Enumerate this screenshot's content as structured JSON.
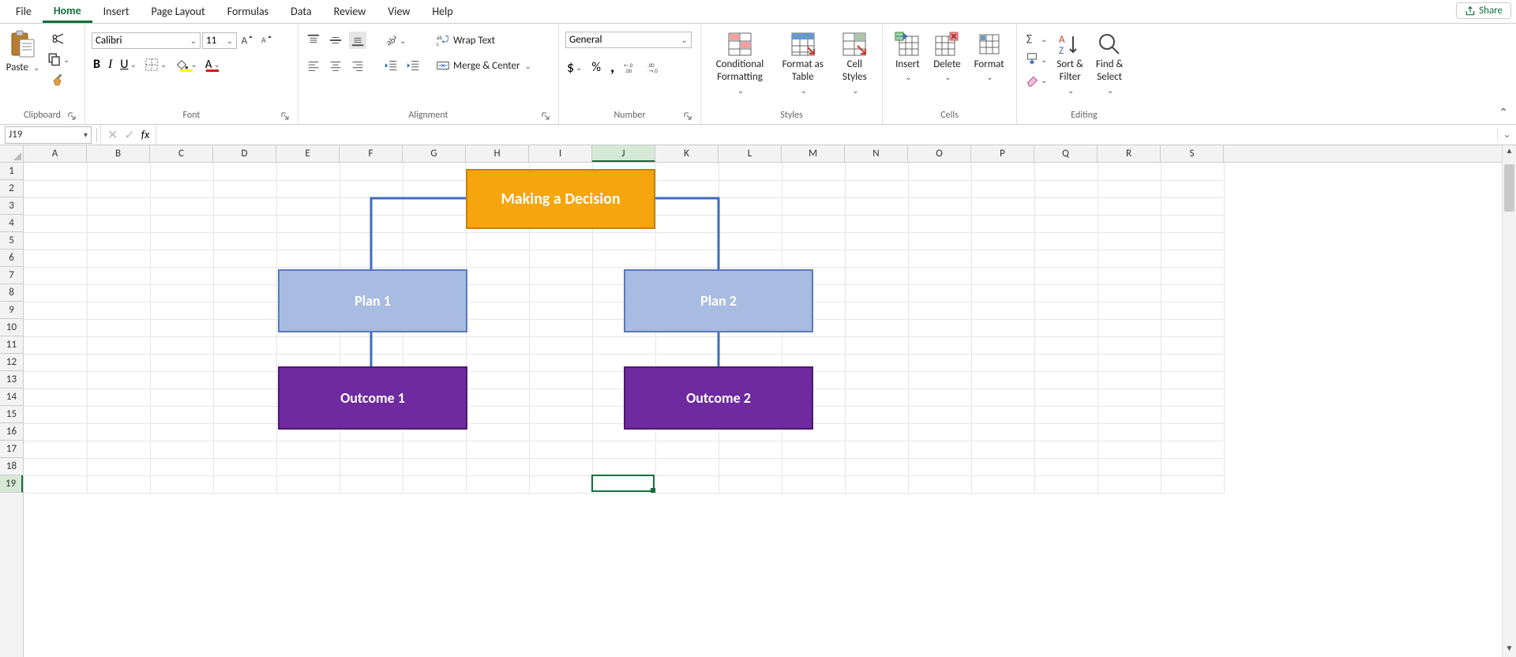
{
  "menu": {
    "tabs": [
      "File",
      "Home",
      "Insert",
      "Page Layout",
      "Formulas",
      "Data",
      "Review",
      "View",
      "Help"
    ],
    "active": "Home",
    "share": "Share"
  },
  "ribbon": {
    "clipboard": {
      "label": "Clipboard",
      "paste": "Paste"
    },
    "font": {
      "label": "Font",
      "name": "Calibri",
      "size": "11"
    },
    "alignment": {
      "label": "Alignment",
      "wrap": "Wrap Text",
      "merge": "Merge & Center"
    },
    "number": {
      "label": "Number",
      "format": "General"
    },
    "styles": {
      "label": "Styles",
      "conditional": "Conditional\nFormatting",
      "formatas": "Format as\nTable",
      "cellstyles": "Cell\nStyles"
    },
    "cells": {
      "label": "Cells",
      "insert": "Insert",
      "delete": "Delete",
      "format": "Format"
    },
    "editing": {
      "label": "Editing",
      "sort": "Sort &\nFilter",
      "find": "Find &\nSelect"
    }
  },
  "fbar": {
    "name": "J19",
    "fx": "fx",
    "value": ""
  },
  "grid": {
    "cols": [
      "A",
      "B",
      "C",
      "D",
      "E",
      "F",
      "G",
      "H",
      "I",
      "J",
      "K",
      "L",
      "M",
      "N",
      "O",
      "P",
      "Q",
      "R",
      "S"
    ],
    "rows": [
      1,
      2,
      3,
      4,
      5,
      6,
      7,
      8,
      9,
      10,
      11,
      12,
      13,
      14,
      15,
      16,
      17,
      18,
      19
    ],
    "active": {
      "col": 9,
      "row": 18
    }
  },
  "diagram": {
    "root": "Making a Decision",
    "plan1": "Plan 1",
    "plan2": "Plan 2",
    "outcome1": "Outcome 1",
    "outcome2": "Outcome 2"
  }
}
